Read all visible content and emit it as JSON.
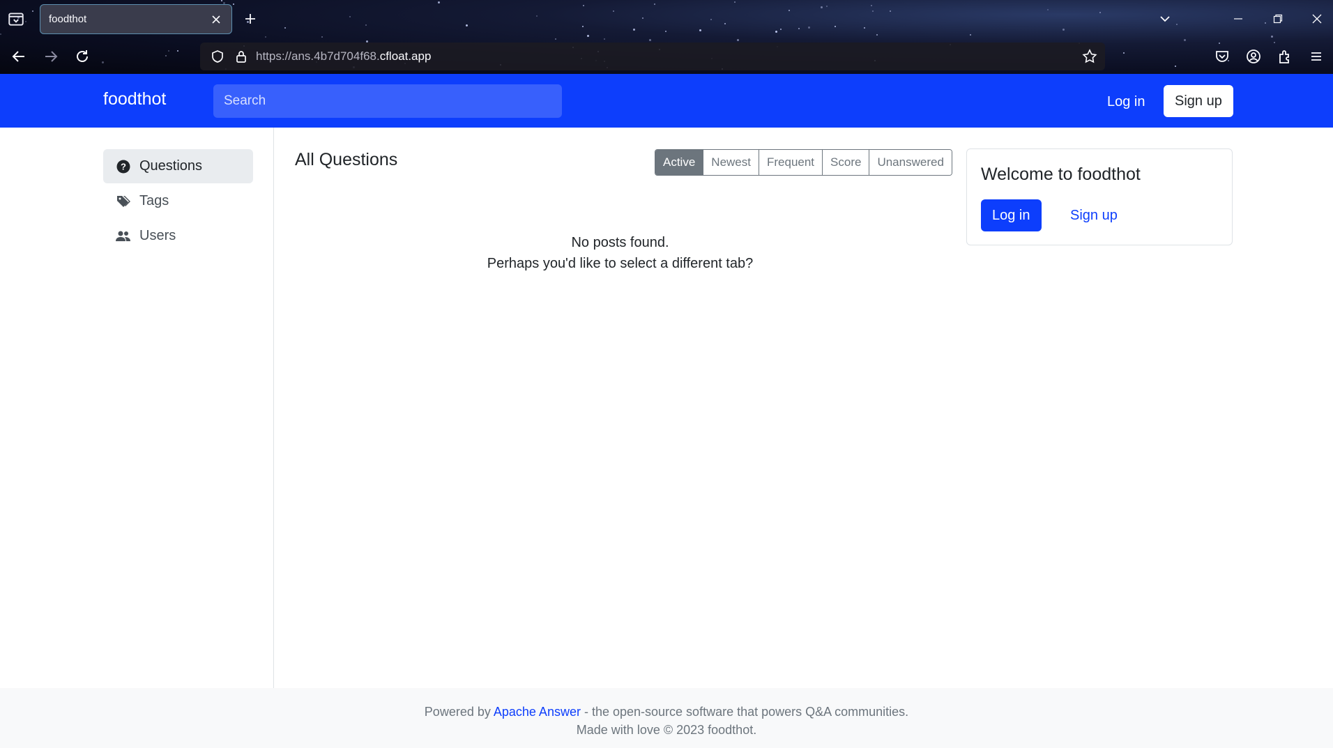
{
  "browser": {
    "tab_title": "foodthot",
    "url_prefix": "https://ans.4b7d704f68.",
    "url_domain": "cfloat.app"
  },
  "header": {
    "brand": "foodthot",
    "search_placeholder": "Search",
    "login_label": "Log in",
    "signup_label": "Sign up",
    "accent_color": "#0d3efc"
  },
  "sidebar": {
    "items": [
      {
        "label": "Questions",
        "icon": "question-circle-icon",
        "active": true
      },
      {
        "label": "Tags",
        "icon": "tags-icon",
        "active": false
      },
      {
        "label": "Users",
        "icon": "people-icon",
        "active": false
      }
    ]
  },
  "main": {
    "title": "All Questions",
    "filters": [
      "Active",
      "Newest",
      "Frequent",
      "Score",
      "Unanswered"
    ],
    "active_filter": "Active",
    "empty_line1": "No posts found.",
    "empty_line2": "Perhaps you'd like to select a different tab?"
  },
  "welcome_card": {
    "title": "Welcome to foodthot",
    "login_label": "Log in",
    "signup_label": "Sign up"
  },
  "footer": {
    "powered_prefix": "Powered by",
    "powered_link": "Apache Answer",
    "powered_suffix": "- the open-source software that powers Q&A communities.",
    "made_with": "Made with love © 2023 foodthot."
  }
}
